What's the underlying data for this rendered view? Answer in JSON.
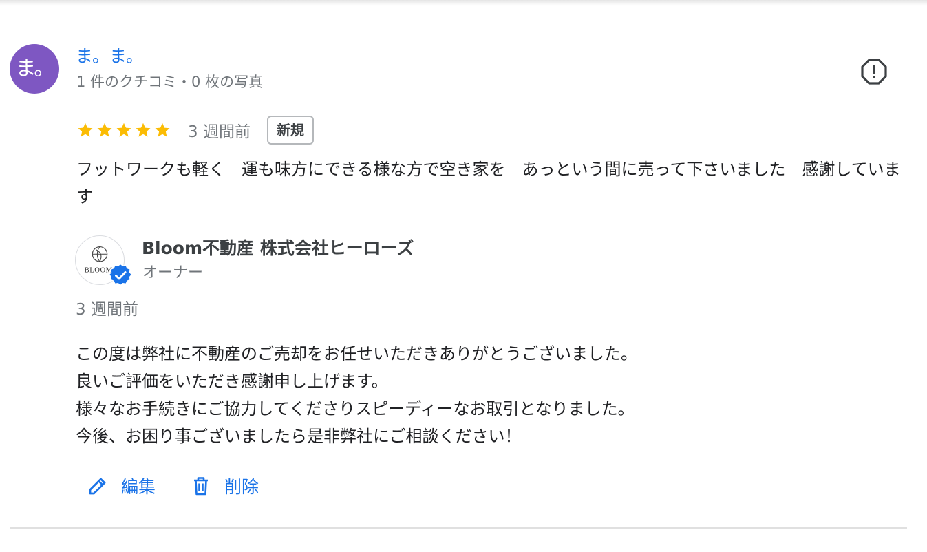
{
  "reviewer": {
    "avatar_text": "ま。",
    "avatar_color": "#7e57c2",
    "name": "ま。ま。",
    "meta": "1 件のクチコミ・0 枚の写真"
  },
  "report_icon": "report-flag-icon",
  "review": {
    "rating": 5,
    "max_rating": 5,
    "date": "3 週間前",
    "badge": "新規",
    "text": "フットワークも軽く　運も味方にできる様な方で空き家を　あっという間に売って下さいました　感謝しています"
  },
  "owner_reply": {
    "logo_text": "BLOOM",
    "business_name": "Bloom不動産 株式会社ヒーローズ",
    "role": "オーナー",
    "date": "3 週間前",
    "lines": [
      "この度は弊社に不動産のご売却をお任せいただきありがとうございました。",
      "良いご評価をいただき感謝申し上げます。",
      "様々なお手続きにご協力してくださりスピーディーなお取引となりました。",
      "今後、お困り事ございましたら是非弊社にご相談ください！"
    ]
  },
  "actions": {
    "edit_label": "編集",
    "delete_label": "削除"
  },
  "colors": {
    "link_blue": "#1a73e8",
    "star_gold": "#fbbc04",
    "verified_blue": "#1a73e8"
  }
}
